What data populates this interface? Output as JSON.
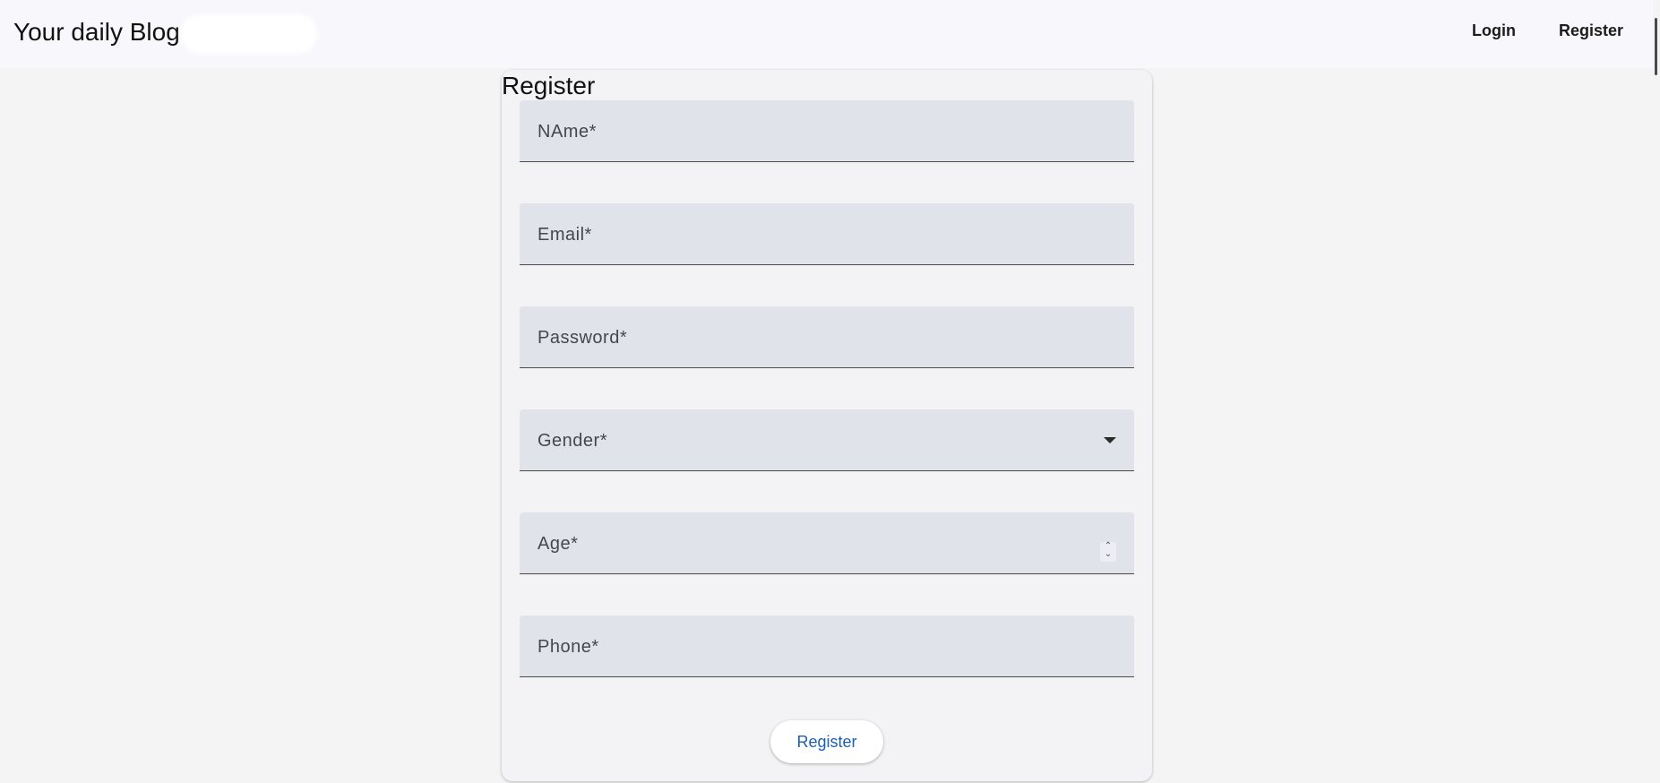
{
  "header": {
    "brand": "Your daily Blog",
    "nav": {
      "login_label": "Login",
      "register_label": "Register"
    }
  },
  "form": {
    "title": "Register",
    "fields": [
      {
        "label": "NAme*",
        "type": "text"
      },
      {
        "label": "Email*",
        "type": "text"
      },
      {
        "label": "Password*",
        "type": "text"
      },
      {
        "label": "Gender*",
        "type": "select"
      },
      {
        "label": "Age*",
        "type": "number"
      },
      {
        "label": "Phone*",
        "type": "text"
      }
    ],
    "submit_label": "Register"
  },
  "colors": {
    "accent": "#1a5fb4",
    "field_background": "#e1e3eb",
    "page_background": "#f4f4f5"
  },
  "icons": {
    "gender_field": "dropdown-arrow-icon",
    "age_field": "number-spinner-icon"
  }
}
